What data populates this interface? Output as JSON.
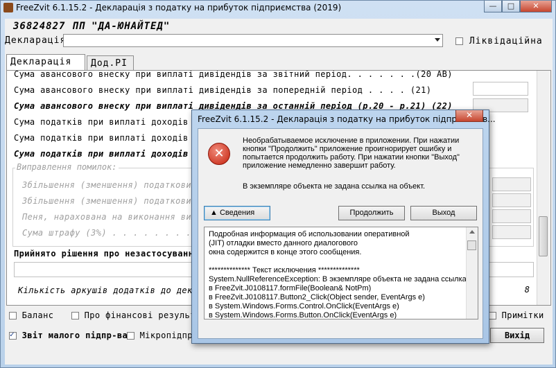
{
  "window": {
    "title": "FreeZvit 6.1.15.2 - Декларація з податку на прибуток підприємства (2019)",
    "minimize": "—",
    "maximize": "□",
    "close": "✕"
  },
  "header": {
    "company": "36824827  ПП \"ДА-ЮНАЙТЕД\"",
    "declaration_label": "Декларація:",
    "declaration_value": "",
    "liquidation_label": "Ліквідаційна",
    "liquidation_checked": false
  },
  "tabs": [
    {
      "label": "Декларація",
      "active": true
    },
    {
      "label": "Дод.РІ",
      "active": false
    }
  ],
  "rows": [
    {
      "text": "Сума авансового внеску при виплаті дивідендів за звітний період. . . . . . .(20 АВ)",
      "style": "normal"
    },
    {
      "text": "Сума авансового внеску при виплаті дивідендів за попередній період . . . . (21)",
      "style": "normal"
    },
    {
      "text": "Сума авансового внеску при виплаті дивідендів за останній період (р.20 - р.21) (22)",
      "style": "bold"
    },
    {
      "text": "Сума податків при виплаті доходів",
      "style": "normal"
    },
    {
      "text": "Сума податків при виплаті доходів",
      "style": "normal"
    },
    {
      "text": "Сума податків при виплаті доходів",
      "style": "bold"
    }
  ],
  "corrections": {
    "title": "Виправлення помилок:",
    "items": [
      "Збільшення (зменшення) податкових",
      "Збільшення (зменшення) податкових",
      "Пеня, нарахована на виконання вимог",
      "Сума штрафу (3%)  . . . . . . . ."
    ]
  },
  "decision_label": "Прийнято рішення про незастосування",
  "sheets_label": "Кількість аркушів додатків до декларації",
  "sheets_value": "8",
  "bottom_checks": [
    {
      "label": "Баланс",
      "checked": false
    },
    {
      "label": "Про фінансові результати",
      "checked": false
    },
    {
      "label": "Звіт малого підпр-ва",
      "checked": true
    },
    {
      "label": "Мікропідпр-",
      "checked": false
    },
    {
      "label": "Примітки",
      "checked": false
    }
  ],
  "exit_button": "Вихід",
  "dialog": {
    "title": "FreeZvit 6.1.15.2 - Декларація з податку на прибуток підприємств...",
    "close": "✕",
    "icon": "error-icon",
    "message": "Необрабатываемое исключение в приложении. При нажатии кнопки \"Продолжить\" приложение проигнорирует ошибку и попытается продолжить работу. При нажатии кнопки \"Выход\" приложение немедленно завершит работу.",
    "message2": "В экземпляре объекта не задана ссылка на объект.",
    "details_button": "▲ Сведения",
    "continue_button": "Продолжить",
    "quit_button": "Выход",
    "details_lines": [
      "Подробная информация об использовании оперативной",
      "(JIT) отладки вместо данного диалогового",
      "окна содержится в конце этого сообщения.",
      "",
      "************** Текст исключения **************",
      "System.NullReferenceException: В экземпляре объекта не задана ссылка на",
      "   в FreeZvit.J0108117.formFile(Boolean& NotPm)",
      "   в FreeZvit.J0108117.Button2_Click(Object sender, EventArgs e)",
      "   в System.Windows.Forms.Control.OnClick(EventArgs e)",
      "   в System.Windows.Forms.Button.OnClick(EventArgs e)"
    ]
  }
}
